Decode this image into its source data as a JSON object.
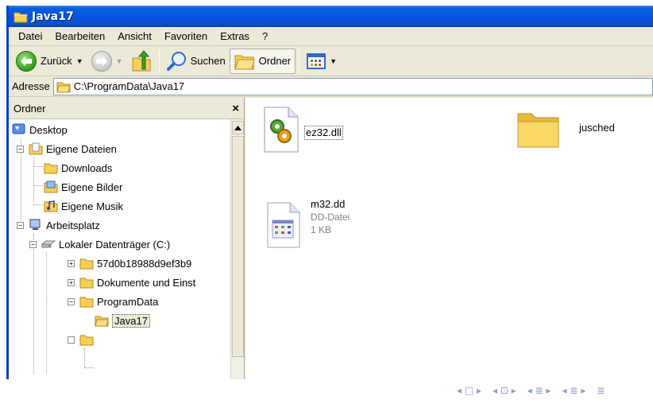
{
  "window": {
    "title": "Java17"
  },
  "menu": [
    "Datei",
    "Bearbeiten",
    "Ansicht",
    "Favoriten",
    "Extras",
    "?"
  ],
  "toolbar": {
    "back_label": "Zurück",
    "search_label": "Suchen",
    "folders_label": "Ordner"
  },
  "address": {
    "label": "Adresse",
    "value": "C:\\ProgramData\\Java17"
  },
  "folder_pane": {
    "title": "Ordner",
    "close": "×",
    "tree": [
      {
        "label": "Desktop",
        "icon": "desktop-icon"
      },
      {
        "label": "Eigene Dateien",
        "icon": "my-documents-icon",
        "expander": "−"
      },
      {
        "label": "Downloads",
        "icon": "folder-icon"
      },
      {
        "label": "Eigene Bilder",
        "icon": "my-pictures-icon"
      },
      {
        "label": "Eigene Musik",
        "icon": "my-music-icon"
      },
      {
        "label": "Arbeitsplatz",
        "icon": "my-computer-icon",
        "expander": "−"
      },
      {
        "label": "Lokaler Datenträger (C:)",
        "icon": "drive-icon",
        "expander": "−"
      },
      {
        "label": "57d0b18988d9ef3b9",
        "icon": "folder-icon",
        "expander": "+"
      },
      {
        "label": "Dokumente und Einst",
        "icon": "folder-icon",
        "expander": "+"
      },
      {
        "label": "ProgramData",
        "icon": "folder-open-icon",
        "expander": "−"
      },
      {
        "label": "Java17",
        "icon": "folder-open-icon",
        "selected": true
      }
    ]
  },
  "files": [
    {
      "name": "ez32.dll",
      "type": "",
      "size": "",
      "icon": "dll-gear-icon"
    },
    {
      "name": "jusched",
      "type": "",
      "size": "",
      "icon": "folder-icon"
    },
    {
      "name": "m32.dd",
      "type": "DD-Datei",
      "size": "1 KB",
      "icon": "generic-file-icon"
    }
  ],
  "colors": {
    "titlebar": "#0654e0",
    "chrome": "#ece9d8",
    "folder": "#f6cf55"
  },
  "beamer_nav": [
    "◂ □ ▸",
    "◂ ⊡ ▸",
    "◂ ≣ ▸",
    "◂ ≣ ▸",
    "≣"
  ]
}
